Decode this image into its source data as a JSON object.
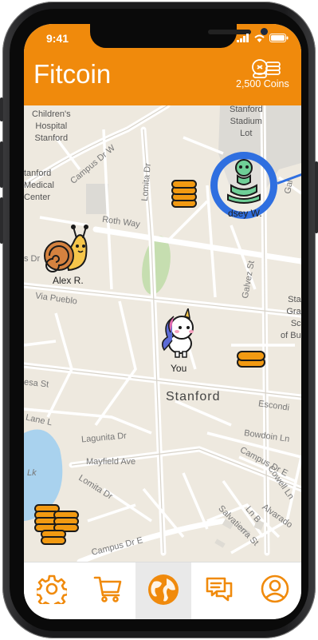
{
  "status": {
    "time": "9:41"
  },
  "header": {
    "title": "Fitcoin",
    "coins_label": "2,500 Coins",
    "coins_icon": "coin-stack-icon"
  },
  "map": {
    "labels": {
      "childrens_hospital": "Children's\nHospital\nStanford",
      "stadium": "Stanford\nStadium\nLot",
      "medical_center": "tanford\nMedical\nCenter",
      "campus_dr_w": "Campus Dr W",
      "lomita_dr_top": "Lomita Dr",
      "roth_way": "Roth Way",
      "galvez_st": "Galvez St",
      "via_pueblo": "Via Pueblo",
      "dr_left": "s Dr",
      "stanford": "Stanford",
      "stanford_gsb": "Sta\nGra\nSc\nof Bu",
      "esa_st": "esa St",
      "escondido": "Escondi",
      "lane_l": "Lane L",
      "lagunita_dr": "Lagunita Dr",
      "mayfield_ave": "Mayfield Ave",
      "bowdoin_ln": "Bowdoin Ln",
      "campus_dr_e_right": "Campus Dr E",
      "cowell_ln": "Cowell Ln",
      "lomita_dr_bottom": "Lomita Dr",
      "alvarado": "Alvarado",
      "ln_b": "Ln B",
      "salvatierra": "Salvatierra St",
      "campus_dr_e_bottom": "Campus Dr E",
      "lk": "Lk",
      "gal": "Gal"
    },
    "users": [
      {
        "name": "Alex R.",
        "avatar": "snail-avatar-icon"
      },
      {
        "name": "You",
        "avatar": "unicorn-avatar-icon"
      },
      {
        "name": "dsey W.",
        "avatar": "snake-avatar-icon"
      }
    ],
    "coin_icon": "coin-stack-icon"
  },
  "tabs": [
    {
      "icon": "gear-icon",
      "active": false
    },
    {
      "icon": "cart-icon",
      "active": false
    },
    {
      "icon": "globe-icon",
      "active": true
    },
    {
      "icon": "chat-icon",
      "active": false
    },
    {
      "icon": "profile-icon",
      "active": false
    }
  ],
  "colors": {
    "accent": "#f08a0c",
    "highlight_ring": "#2f6fe0",
    "map_bg": "#eee9df",
    "park": "#c6deb0",
    "water": "#a9d2ee"
  }
}
